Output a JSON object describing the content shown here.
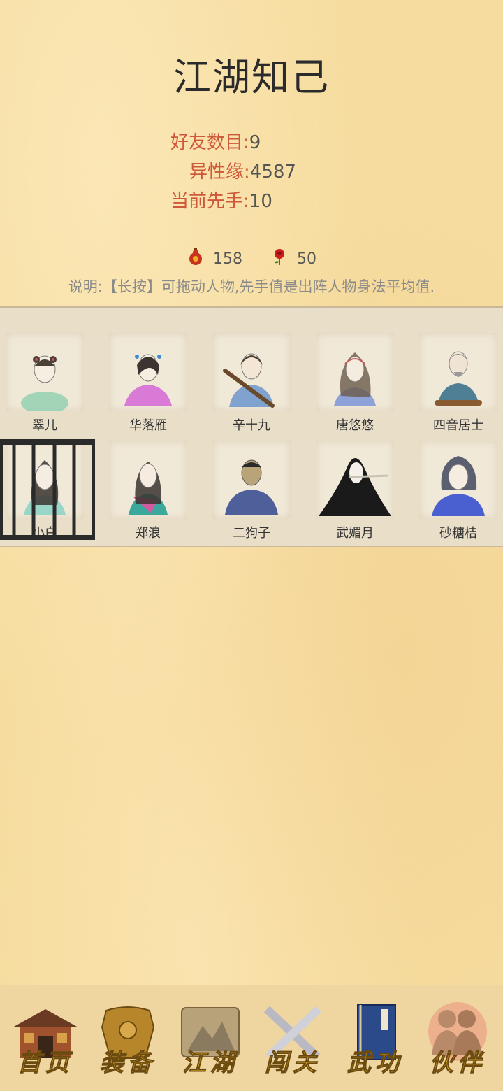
{
  "title": "江湖知己",
  "stats": [
    {
      "label": "好友数目",
      "value": "9"
    },
    {
      "label": "异性缘",
      "value": "4587"
    },
    {
      "label": "当前先手",
      "value": "10"
    }
  ],
  "resources": {
    "gourd": {
      "icon": "wine-gourd-icon",
      "value": "158"
    },
    "rose": {
      "icon": "rose-icon",
      "value": "50"
    }
  },
  "note": "说明:【长按】可拖动人物,先手值是出阵人物身法平均值.",
  "characters": [
    {
      "name": "翠儿"
    },
    {
      "name": "华落雁"
    },
    {
      "name": "辛十九"
    },
    {
      "name": "唐悠悠"
    },
    {
      "name": "四音居士"
    },
    {
      "name": "小白",
      "caged": true
    },
    {
      "name": "郑浪"
    },
    {
      "name": "二狗子"
    },
    {
      "name": "武媚月"
    },
    {
      "name": "砂糖桔"
    }
  ],
  "nav": [
    {
      "label": "首页",
      "icon": "house-icon"
    },
    {
      "label": "装备",
      "icon": "armor-icon"
    },
    {
      "label": "江湖",
      "icon": "scroll-map-icon"
    },
    {
      "label": "闯关",
      "icon": "crossed-swords-icon"
    },
    {
      "label": "武功",
      "icon": "book-icon"
    },
    {
      "label": "伙伴",
      "icon": "companions-icon",
      "active": true
    }
  ]
}
